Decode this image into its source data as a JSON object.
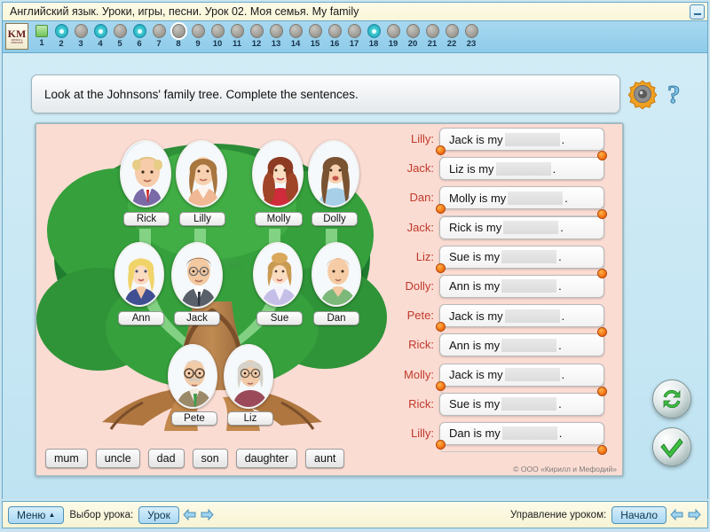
{
  "window": {
    "title": "Английский язык. Уроки, игры, песни. Урок 02. Моя семья. My family",
    "minimize_label": "—"
  },
  "logo": {
    "initials": "KM",
    "sub": "КИРИЛЛ и МЕФОДИЙ"
  },
  "nav": {
    "items": [
      {
        "num": "1",
        "type": "pic",
        "selected": false
      },
      {
        "num": "2",
        "type": "flower",
        "selected": false
      },
      {
        "num": "3",
        "type": "plain",
        "selected": false
      },
      {
        "num": "4",
        "type": "flower",
        "selected": false
      },
      {
        "num": "5",
        "type": "plain",
        "selected": false
      },
      {
        "num": "6",
        "type": "flower",
        "selected": false
      },
      {
        "num": "7",
        "type": "plain",
        "selected": false
      },
      {
        "num": "8",
        "type": "plain",
        "selected": true
      },
      {
        "num": "9",
        "type": "plain",
        "selected": false
      },
      {
        "num": "10",
        "type": "plain",
        "selected": false
      },
      {
        "num": "11",
        "type": "plain",
        "selected": false
      },
      {
        "num": "12",
        "type": "plain",
        "selected": false
      },
      {
        "num": "13",
        "type": "plain",
        "selected": false
      },
      {
        "num": "14",
        "type": "plain",
        "selected": false
      },
      {
        "num": "15",
        "type": "plain",
        "selected": false
      },
      {
        "num": "16",
        "type": "plain",
        "selected": false
      },
      {
        "num": "17",
        "type": "plain",
        "selected": false
      },
      {
        "num": "18",
        "type": "flower",
        "selected": false
      },
      {
        "num": "19",
        "type": "plain",
        "selected": false
      },
      {
        "num": "20",
        "type": "plain",
        "selected": false
      },
      {
        "num": "21",
        "type": "plain",
        "selected": false
      },
      {
        "num": "22",
        "type": "plain",
        "selected": false
      },
      {
        "num": "23",
        "type": "plain",
        "selected": false
      }
    ]
  },
  "instruction": {
    "text": "Look at the Johnsons' family tree. Complete the sentences.",
    "speaker_icon": "speaker-icon",
    "help_icon": "question-mark-icon"
  },
  "tree": {
    "generations": [
      {
        "row": "children",
        "members": [
          {
            "name": "Rick",
            "desc": "boy with curly blond hair, purple sweater, red tie"
          },
          {
            "name": "Lilly",
            "desc": "girl with long brown hair, peach top"
          },
          {
            "name": "Molly",
            "desc": "woman with long auburn wavy hair, red dress"
          },
          {
            "name": "Dolly",
            "desc": "girl with long brown hair, light blue top"
          }
        ]
      },
      {
        "row": "parents",
        "members": [
          {
            "name": "Ann",
            "desc": "blonde woman in blue jacket"
          },
          {
            "name": "Jack",
            "desc": "man with glasses, grey suit and tie"
          },
          {
            "name": "Sue",
            "desc": "woman with updo hair, lavender jacket"
          },
          {
            "name": "Dan",
            "desc": "young man, green shirt"
          }
        ]
      },
      {
        "row": "grandparents",
        "members": [
          {
            "name": "Pete",
            "desc": "elderly man with glasses, moustache, green tie"
          },
          {
            "name": "Liz",
            "desc": "elderly woman with grey hair, glasses, maroon top"
          }
        ]
      }
    ]
  },
  "wordbank": {
    "words": [
      "mum",
      "uncle",
      "dad",
      "son",
      "daughter",
      "aunt"
    ]
  },
  "sentences": {
    "rows": [
      {
        "speaker": "Lilly:",
        "prefix": "Jack is my",
        "answer": "",
        "period": ".",
        "has_dropzone": true
      },
      {
        "speaker": "Jack:",
        "prefix": "Liz is my",
        "answer": "",
        "period": ".",
        "has_dropzone": false
      },
      {
        "speaker": "Dan:",
        "prefix": "Molly is my",
        "answer": "",
        "period": ".",
        "has_dropzone": true
      },
      {
        "speaker": "Jack:",
        "prefix": "Rick is my",
        "answer": "",
        "period": ".",
        "has_dropzone": false
      },
      {
        "speaker": "Liz:",
        "prefix": "Sue is my",
        "answer": "",
        "period": ".",
        "has_dropzone": true
      },
      {
        "speaker": "Dolly:",
        "prefix": "Ann is my",
        "answer": "",
        "period": ".",
        "has_dropzone": false
      },
      {
        "speaker": "Pete:",
        "prefix": "Jack is my",
        "answer": "",
        "period": ".",
        "has_dropzone": true
      },
      {
        "speaker": "Rick:",
        "prefix": "Ann is my",
        "answer": "",
        "period": ".",
        "has_dropzone": false
      },
      {
        "speaker": "Molly:",
        "prefix": "Jack is my",
        "answer": "",
        "period": ".",
        "has_dropzone": true
      },
      {
        "speaker": "Rick:",
        "prefix": "Sue is my",
        "answer": "",
        "period": ".",
        "has_dropzone": false
      },
      {
        "speaker": "Lilly:",
        "prefix": "Dan is my",
        "answer": "",
        "period": ".",
        "has_dropzone": true
      }
    ]
  },
  "actions": {
    "reset_icon": "refresh-arrows-icon",
    "check_icon": "checkmark-icon"
  },
  "copyright": "© ООО «Кирилл и Мефодий»",
  "bottombar": {
    "menu_label": "Меню",
    "menu_caret": "▲",
    "lesson_select_label": "Выбор урока:",
    "lesson_button": "Урок",
    "lesson_control_label": "Управление уроком:",
    "start_button": "Начало"
  },
  "colors": {
    "title_bg": "#fdfbe8",
    "nav_bg": "#8ecbe9",
    "stage_bg": "#c9e4f0",
    "panel_bg": "#fbdcd3",
    "speaker_name": "#c0392b",
    "handle_orange": "#ef6c10",
    "accent_blue": "#4e92b8"
  }
}
